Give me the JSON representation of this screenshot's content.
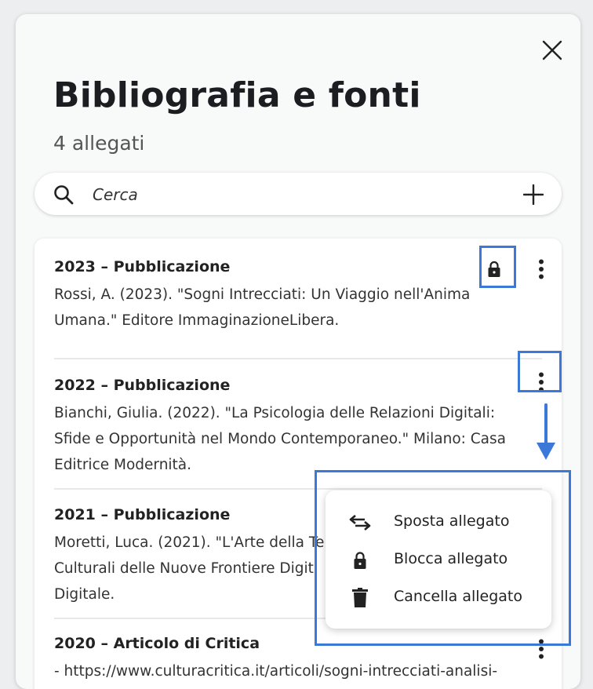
{
  "dialog": {
    "title": "Bibliografia e fonti",
    "subtitle": "4 allegati"
  },
  "search": {
    "placeholder": "Cerca"
  },
  "icons": {
    "close": "close-icon",
    "search": "search-icon",
    "add": "plus-icon",
    "lock": "lock-icon",
    "more": "more-vertical-icon",
    "move": "swap-arrows-icon",
    "delete": "trash-icon"
  },
  "items": [
    {
      "title": "2023 – Pubblicazione",
      "lines": [
        "Rossi, A. (2023). \"Sogni Intrecciati: Un Viaggio nell'Anima",
        "Umana.\" Editore ImmaginazioneLibera."
      ]
    },
    {
      "title": "2022 – Pubblicazione",
      "lines": [
        "Bianchi, Giulia. (2022). \"La Psicologia delle Relazioni Digitali:",
        "Sfide e Opportunità nel Mondo Contemporaneo.\" Milano: Casa",
        "Editrice Modernità."
      ]
    },
    {
      "title": "2021 – Pubblicazione",
      "lines": [
        "Moretti, Luca. (2021). \"L'Arte della Te",
        "Culturali delle Nuove Frontiere Digit",
        "Digitale."
      ]
    },
    {
      "title": "2020 – Articolo di Critica",
      "lines": [
        "- https://www.culturacritica.it/articoli/sogni-intrecciati-analisi-"
      ]
    }
  ],
  "menu": {
    "items": [
      {
        "label": "Sposta allegato",
        "icon": "swap-arrows-icon"
      },
      {
        "label": "Blocca allegato",
        "icon": "lock-icon"
      },
      {
        "label": "Cancella allegato",
        "icon": "trash-icon"
      }
    ]
  },
  "colors": {
    "highlight": "#3b78d8",
    "background": "#eceef0",
    "panel": "#f8f9f9"
  }
}
